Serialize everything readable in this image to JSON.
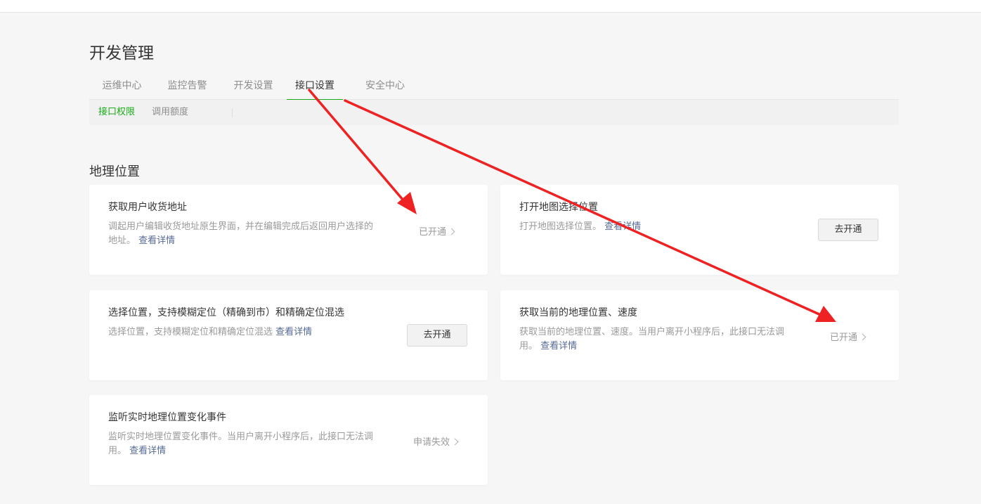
{
  "page": {
    "title": "开发管理"
  },
  "tabs": [
    {
      "label": "运维中心"
    },
    {
      "label": "监控告警"
    },
    {
      "label": "开发设置"
    },
    {
      "label": "接口设置",
      "active": true
    },
    {
      "label": "安全中心"
    }
  ],
  "subnav": [
    {
      "label": "接口权限",
      "active": true
    },
    {
      "label": "调用额度"
    }
  ],
  "section": {
    "title": "地理位置"
  },
  "cards": [
    {
      "title": "获取用户收货地址",
      "desc": "调起用户编辑收货地址原生界面，并在编辑完成后返回用户选择的地址。",
      "link": "查看详情",
      "status": "已开通"
    },
    {
      "title": "打开地图选择位置",
      "desc": "打开地图选择位置。",
      "link": "查看详情",
      "button": "去开通"
    },
    {
      "title": "选择位置，支持模糊定位（精确到市）和精确定位混选",
      "desc": "选择位置，支持模糊定位和精确定位混选",
      "link": "查看详情",
      "button": "去开通"
    },
    {
      "title": "获取当前的地理位置、速度",
      "desc": "获取当前的地理位置、速度。当用户离开小程序后，此接口无法调用。",
      "link": "查看详情",
      "status": "已开通"
    },
    {
      "title": "监听实时地理位置变化事件",
      "desc": "监听实时地理位置变化事件。当用户离开小程序后，此接口无法调用。",
      "link": "查看详情",
      "status": "申请失效"
    }
  ],
  "colors": {
    "accent": "#1aad19",
    "link": "#576b95",
    "annotation_arrow": "#ee2222",
    "page_bg": "#f6f6f6"
  }
}
